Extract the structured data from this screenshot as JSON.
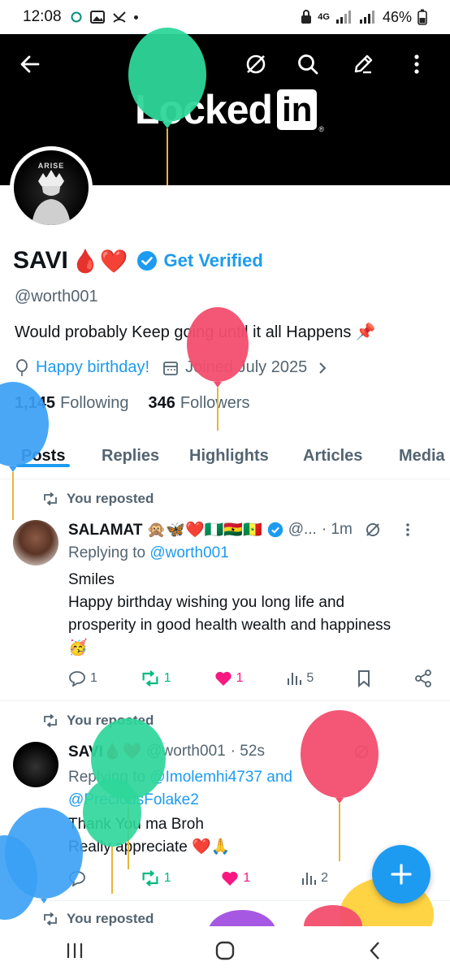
{
  "status_bar": {
    "time": "12:08",
    "network": "4G",
    "battery": "46%"
  },
  "header": {
    "banner_logo_text": "Locked",
    "banner_logo_in": "in",
    "banner_logo_reg": "®",
    "avatar_text": "ARISE"
  },
  "profile": {
    "name": "SAVI",
    "name_emoji": "🩸❤️",
    "get_verified": "Get Verified",
    "handle": "@worth001",
    "bio": "Would probably Keep going until it all Happens 📌",
    "birthday": "Happy birthday!",
    "joined": "Joined July 2025",
    "following_count": "1,145",
    "following_label": "Following",
    "followers_count": "346",
    "followers_label": "Followers"
  },
  "tabs": [
    {
      "label": "Posts",
      "active": true
    },
    {
      "label": "Replies"
    },
    {
      "label": "Highlights"
    },
    {
      "label": "Articles"
    },
    {
      "label": "Media"
    }
  ],
  "posts": [
    {
      "repost_label": "You reposted",
      "author": "SALAMAT 🙊🦋❤️🇳🇬🇬🇭🇸🇳",
      "handle": "@...",
      "time": "· 1m",
      "replying_prefix": "Replying to",
      "replying_to": "@worth001",
      "text_line1": "Smiles",
      "text_line2": "Happy birthday wishing you long life and prosperity in good health wealth and happiness 🥳",
      "replies": "1",
      "reposts": "1",
      "likes": "1",
      "views": "5"
    },
    {
      "repost_label": "You reposted",
      "author": "SAVI🩸❤️",
      "handle": "@worth001",
      "time": "· 52s",
      "replying_prefix": "Replying to",
      "replying_to": "@Imolemhi4737 and @PreciousFolake2",
      "text_line1": "Thank You ma Broh",
      "text_line2": "Really appreciate ❤️🙏",
      "replies": "",
      "reposts": "1",
      "likes": "1",
      "views": "2"
    },
    {
      "repost_label": "You reposted"
    }
  ],
  "colors": {
    "accent": "#1d9bf0",
    "like": "#f91880",
    "repost": "#00ba7c",
    "muted": "#536471"
  }
}
